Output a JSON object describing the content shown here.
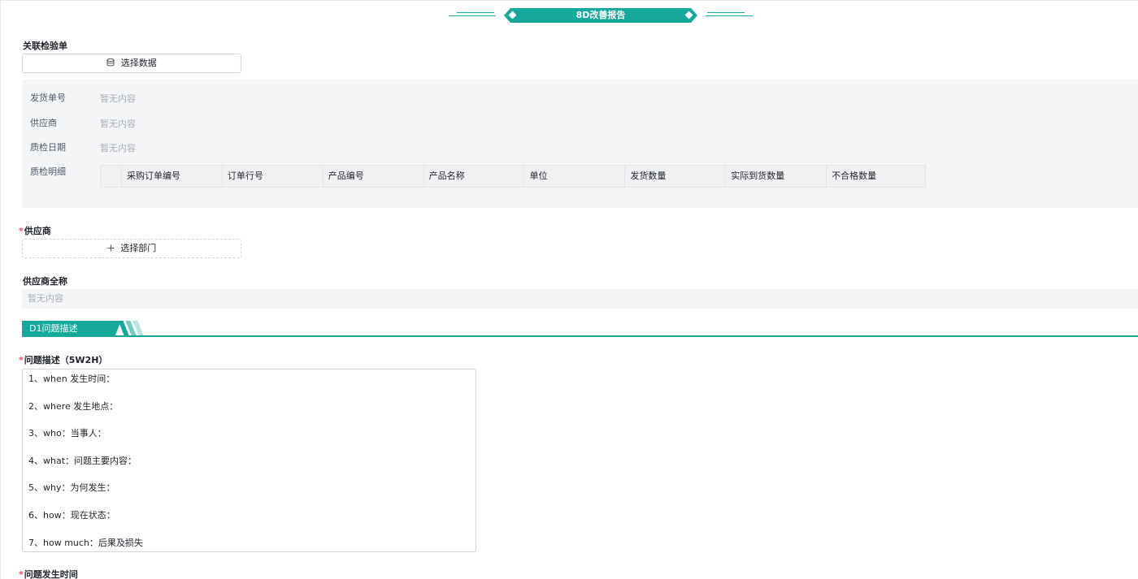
{
  "banner": {
    "title": "8D改善报告"
  },
  "related": {
    "label": "关联检验单",
    "select_label": "选择数据",
    "select_icon": "database-icon"
  },
  "info": {
    "rows": [
      {
        "key": "发货单号",
        "value": "暂无内容"
      },
      {
        "key": "供应商",
        "value": "暂无内容"
      },
      {
        "key": "质检日期",
        "value": "暂无内容"
      },
      {
        "key": "质检明细",
        "value": ""
      }
    ],
    "table_columns": [
      "采购订单编号",
      "订单行号",
      "产品编号",
      "产品名称",
      "单位",
      "发货数量",
      "实际到货数量",
      "不合格数量"
    ]
  },
  "supplier": {
    "required_mark": "*",
    "label": "供应商",
    "select_label": "选择部门",
    "select_icon": "plus-icon"
  },
  "supplier_fullname": {
    "label": "供应商全称",
    "value": "暂无内容"
  },
  "d1": {
    "title": "D1问题描述"
  },
  "problem_desc": {
    "required_mark": "*",
    "label": "问题描述（5W2H）",
    "lines": [
      "1、when 发生时间：",
      "2、where 发生地点：",
      "3、who：当事人：",
      "4、what：问题主要内容：",
      "5、why：为何发生：",
      "6、how：现在状态：",
      "7、how much：后果及损失"
    ]
  },
  "problem_time": {
    "required_mark": "*",
    "label": "问题发生时间"
  },
  "colors": {
    "accent": "#14a99a",
    "required": "#e34d59"
  }
}
